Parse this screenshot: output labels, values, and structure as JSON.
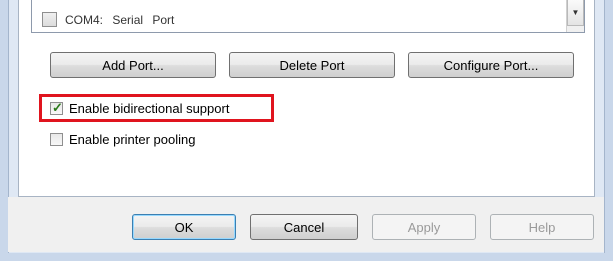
{
  "port_list": {
    "rows": [
      {
        "port": "COM4:",
        "description": "Serial Port",
        "checked": false
      }
    ],
    "scroll_down_icon": "chevron-down-icon"
  },
  "port_buttons": {
    "add": "Add Port...",
    "delete": "Delete Port",
    "configure": "Configure Port..."
  },
  "options": {
    "bidirectional": {
      "label": "Enable bidirectional support",
      "checked": true
    },
    "pooling": {
      "label": "Enable printer pooling",
      "checked": false
    }
  },
  "dialog_buttons": {
    "ok": "OK",
    "cancel": "Cancel",
    "apply": "Apply",
    "help": "Help"
  },
  "colors": {
    "highlight": "#e0141e",
    "check": "#2a7a1a"
  }
}
